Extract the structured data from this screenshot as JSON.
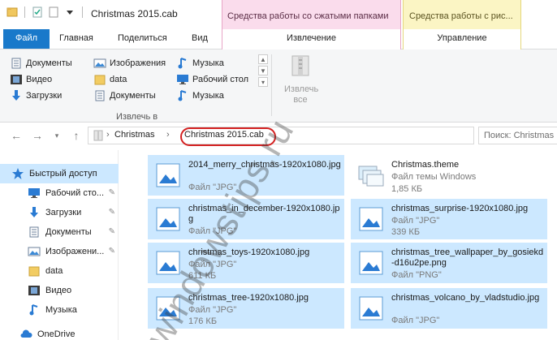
{
  "window": {
    "title": "Christmas 2015.cab",
    "context_tab_1": "Средства работы со сжатыми папками",
    "context_tab_2": "Средства работы с рис..."
  },
  "tabs": [
    "Файл",
    "Главная",
    "Поделиться",
    "Вид",
    "Извлечение",
    "Управление"
  ],
  "ribbon": {
    "col1": [
      "Документы",
      "Видео",
      "Загрузки"
    ],
    "col2": [
      "Изображения",
      "data",
      "Документы"
    ],
    "col3": [
      "Музыка",
      "Рабочий стол",
      "Музыка"
    ],
    "group_label": "Извлечь в",
    "extract_all": "Извлечь все"
  },
  "address": {
    "crumbs": [
      "Christmas",
      "Christmas 2015.cab"
    ],
    "search_placeholder": "Поиск: Christmas"
  },
  "nav": {
    "items": [
      {
        "label": "Быстрый доступ",
        "icon": "star-icon"
      },
      {
        "label": "Рабочий сто...",
        "icon": "desktop-icon"
      },
      {
        "label": "Загрузки",
        "icon": "download-icon"
      },
      {
        "label": "Документы",
        "icon": "documents-icon"
      },
      {
        "label": "Изображени...",
        "icon": "pictures-icon"
      },
      {
        "label": "data",
        "icon": "folder-icon"
      },
      {
        "label": "Видео",
        "icon": "video-icon"
      },
      {
        "label": "Музыка",
        "icon": "music-icon"
      },
      {
        "label": "OneDrive",
        "icon": "cloud-icon"
      }
    ]
  },
  "files": [
    {
      "name": "2014_merry_christmas-1920x1080.jpg",
      "type": "Файл \"JPG\"",
      "size": "",
      "selected": true,
      "icon": "image-icon"
    },
    {
      "name": "Christmas.theme",
      "type": "Файл темы Windows",
      "size": "1,85 КБ",
      "selected": false,
      "icon": "theme-icon"
    },
    {
      "name": "christmas_in_december-1920x1080.jpg",
      "type": "Файл \"JPG\"",
      "size": "",
      "selected": true,
      "icon": "image-icon"
    },
    {
      "name": "christmas_surprise-1920x1080.jpg",
      "type": "Файл \"JPG\"",
      "size": "339 КБ",
      "selected": true,
      "icon": "image-icon"
    },
    {
      "name": "christmas_toys-1920x1080.jpg",
      "type": "Файл \"JPG\"",
      "size": "611 КБ",
      "selected": true,
      "icon": "image-icon"
    },
    {
      "name": "christmas_tree_wallpaper_by_gosiekd-d16u2pe.png",
      "type": "Файл \"PNG\"",
      "size": "",
      "selected": true,
      "icon": "image-icon"
    },
    {
      "name": "christmas_tree-1920x1080.jpg",
      "type": "Файл \"JPG\"",
      "size": "176 КБ",
      "selected": true,
      "icon": "image-icon"
    },
    {
      "name": "christmas_volcano_by_vladstudio.jpg",
      "type": "Файл \"JPG\"",
      "size": "",
      "selected": true,
      "icon": "image-icon"
    }
  ],
  "watermark": "windowstips.ru",
  "colors": {
    "accent": "#1979ca",
    "selection": "#cce8ff",
    "ctx_pink": "#fadcec",
    "ctx_yellow": "#fbf5c4",
    "ring": "#d32020"
  }
}
